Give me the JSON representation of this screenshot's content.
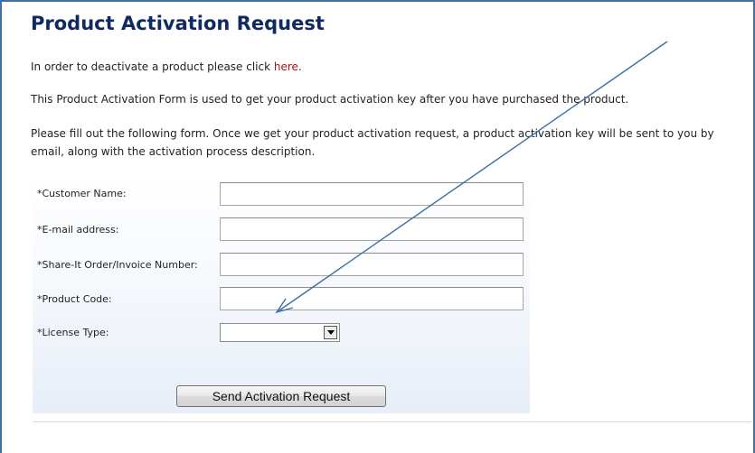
{
  "page": {
    "title": "Product Activation Request",
    "deactivate_text": "In order to deactivate a product please click ",
    "deactivate_link": "here",
    "deactivate_suffix": ".",
    "description": "This Product Activation Form is used to get your product activation key after you have purchased the product.",
    "instructions": "Please fill out the following form. Once we get your product activation request, a product activation key will be sent to you by email, along with the activation process description."
  },
  "form": {
    "fields": [
      {
        "label": "*Customer Name:",
        "value": ""
      },
      {
        "label": "*E-mail address:",
        "value": ""
      },
      {
        "label": "*Share-It Order/Invoice Number:",
        "value": ""
      },
      {
        "label": "*Product Code:",
        "value": ""
      }
    ],
    "license": {
      "label": "*License Type:",
      "selected": ""
    },
    "submit_label": "Send Activation Request"
  },
  "colors": {
    "title": "#0f2a62",
    "link": "#a51313",
    "frame_border": "#3d6fa8",
    "annotation_arrow": "#3d6fa8"
  },
  "icons": [
    "chevron-down-icon",
    "annotation-arrow"
  ]
}
